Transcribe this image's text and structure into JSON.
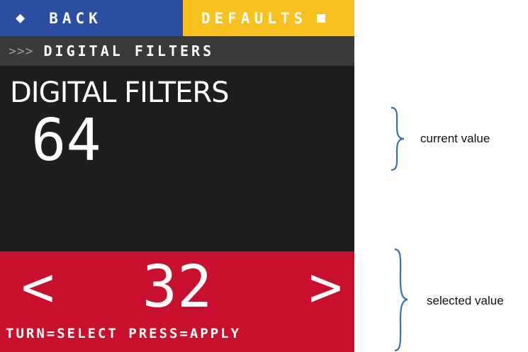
{
  "topbar": {
    "back_icon": "arrow-left-icon",
    "back_arrow": "◆",
    "back_label": "BACK",
    "defaults_label": "DEFAULTS",
    "defaults_icon": "square-icon"
  },
  "breadcrumb": {
    "chevrons": ">>>",
    "current": "DIGITAL FILTERS"
  },
  "setting": {
    "title": "DIGITAL FILTERS",
    "current_value": "64"
  },
  "selector": {
    "prev_glyph": "<",
    "next_glyph": ">",
    "selected_value": "32",
    "hint": "TURN=SELECT PRESS=APPLY"
  },
  "annotations": {
    "current": "current value",
    "selected": "selected value"
  },
  "colors": {
    "back": "#2b4ea2",
    "defaults": "#f7c21f",
    "screen": "#1e1e1e",
    "breadcrumb": "#3a3a3a",
    "selector": "#c8102e",
    "brace": "#3a6fb0"
  }
}
